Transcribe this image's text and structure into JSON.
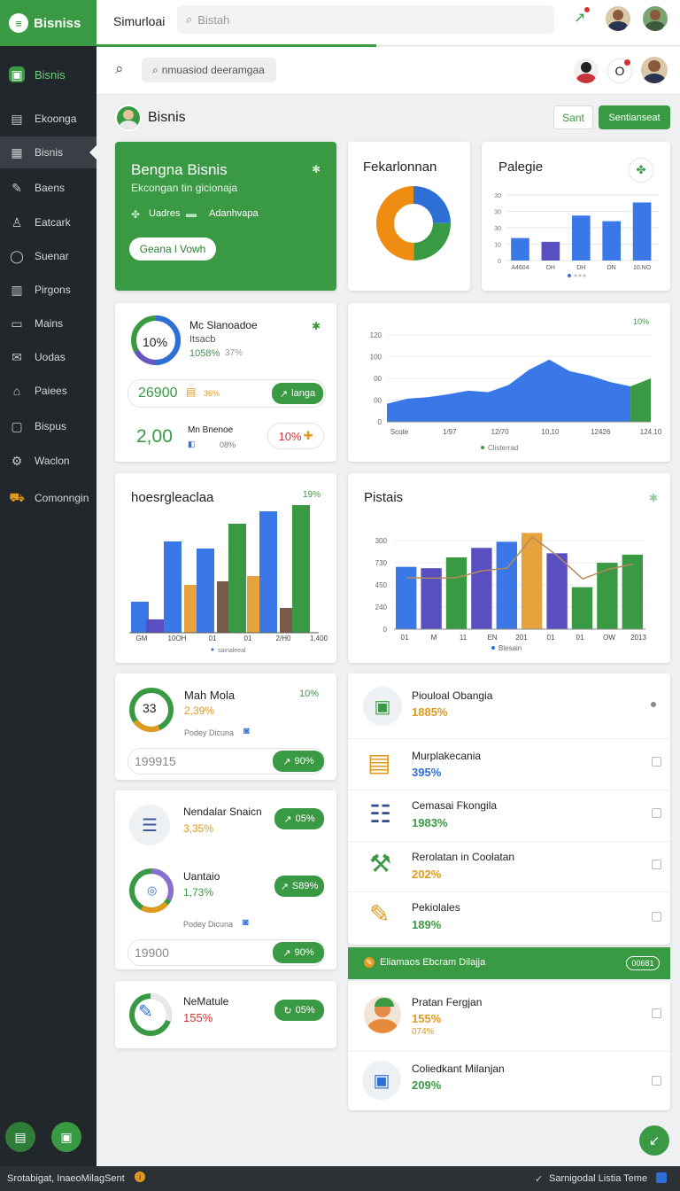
{
  "topbar": {
    "brand": "Bisniss",
    "title": "Simurloai",
    "search_placeholder": "Bistah"
  },
  "subbar": {
    "search_text": "nmuasiod deeramgaa"
  },
  "sidebar": {
    "header": "Bisnis",
    "items": [
      {
        "label": "Ekoonga",
        "icon": "briefcase-icon"
      },
      {
        "label": "Bisnis",
        "icon": "bag-icon",
        "active": true
      },
      {
        "label": "Baens",
        "icon": "wrench-icon"
      },
      {
        "label": "Eatcark",
        "icon": "person-icon"
      },
      {
        "label": "Suenar",
        "icon": "circle-icon"
      },
      {
        "label": "Pirgons",
        "icon": "cart-icon"
      },
      {
        "label": "Mains",
        "icon": "tray-icon"
      },
      {
        "label": "Uodas",
        "icon": "mail-icon"
      },
      {
        "label": "Paiees",
        "icon": "home-icon"
      },
      {
        "label": "Bispus",
        "icon": "square-icon"
      },
      {
        "label": "Waclon",
        "icon": "tools-icon"
      },
      {
        "label": "Comonngin",
        "icon": "truck-icon"
      }
    ]
  },
  "page": {
    "title": "Bisnis",
    "btn_secondary": "Sant",
    "btn_primary": "Sentianseat"
  },
  "hero": {
    "title": "Bengna Bisnis",
    "subtitle": "Ekcongan tin gicionaja",
    "tag1": "Uadres",
    "tag2": "Adanhvapa",
    "button": "Geana l Vowh"
  },
  "donut_card": {
    "title": "Fekarlonnan"
  },
  "palegie": {
    "title": "Palegie",
    "chart_data": {
      "type": "bar",
      "categories": [
        "A4604",
        "DH",
        "DH",
        "DN",
        "10.NO"
      ],
      "values": [
        12,
        10,
        24,
        21,
        31
      ],
      "y_ticks": [
        "30",
        "30",
        "30",
        "10",
        "0"
      ],
      "ylim": [
        0,
        35
      ]
    }
  },
  "stats1": {
    "ring_value": "10%",
    "title": "Mc Slanoadoe",
    "sub1": "Itsacb",
    "pct_green": "1058%",
    "pct_gray": "37%",
    "row1_value": "26900",
    "row1_pct": "36%",
    "row1_btn": "langa",
    "row2_value": "2,00",
    "row2_label": "Mn Bnenoe",
    "row2_pct": "08%",
    "row2_badge": "10%"
  },
  "area_chart": {
    "corner": "10%",
    "legend": "Clisterrad",
    "chart_data": {
      "type": "area",
      "x_labels": [
        "Scote",
        "1/97",
        "12/70",
        "10,10",
        "12426",
        "124,10"
      ],
      "values": [
        25,
        32,
        34,
        38,
        43,
        41,
        51,
        72,
        86,
        70,
        64,
        55,
        49,
        60
      ],
      "y_ticks": [
        "120",
        "100",
        "00",
        "00",
        "0"
      ],
      "ylim": [
        0,
        120
      ]
    }
  },
  "bars_chart": {
    "title": "hoesrgleaclaa",
    "corner": "19%",
    "legend": "sainaleeal",
    "chart_data": {
      "type": "bar",
      "categories": [
        "GM",
        "10OH",
        "01",
        "01",
        "2/H0",
        "1,400"
      ],
      "series": [
        {
          "values": [
            23,
            9,
            0,
            9,
            48,
            25
          ]
        },
        {
          "values": [
            52,
            55,
            47,
            50,
            73,
            91
          ]
        },
        {
          "values": [
            12,
            28,
            32,
            0,
            33,
            10
          ]
        },
        {
          "values": [
            0,
            0,
            0,
            0,
            0,
            0
          ]
        }
      ],
      "x_values": [
        5,
        12,
        32,
        34,
        37,
        70,
        72,
        62,
        48,
        51,
        65,
        80,
        21,
        100
      ],
      "ylim": [
        0,
        100
      ]
    }
  },
  "pistais": {
    "title": "Pistais",
    "legend": "Blesain",
    "chart_data": {
      "type": "bar",
      "categories": [
        "01",
        "M",
        "11",
        "EN",
        "201",
        "01",
        "01",
        "OW",
        "2013"
      ],
      "values": [
        460,
        450,
        530,
        600,
        645,
        710,
        560,
        310,
        490,
        550
      ],
      "line": [
        420,
        415,
        420,
        470,
        490,
        720,
        580,
        410,
        480,
        520
      ],
      "y_ticks": [
        "300",
        "730",
        "450",
        "240",
        "0"
      ],
      "ylim": [
        0,
        850
      ]
    }
  },
  "card_mah": {
    "ring_value": "33",
    "title": "Mah Mola",
    "pct": "2,39%",
    "corner": "10%",
    "meta": "Podey Dicuna",
    "input_value": "199915",
    "btn": "90%"
  },
  "card_nend": {
    "title": "Nendalar Snaicn",
    "pct": "3,35%",
    "btn1": "05%",
    "title2": "Uantaio",
    "pct2": "1,73%",
    "btn2": "S89%",
    "meta": "Podey Dicuna",
    "input_value": "19900",
    "btn3": "90%"
  },
  "card_ne": {
    "title": "NeMatule",
    "pct": "155%",
    "btn": "05%"
  },
  "list": [
    {
      "title": "Piouloal Obangia",
      "value": "1885%",
      "icon": "monitor-icon"
    },
    {
      "title": "Murplakecania",
      "value": "395%",
      "icon": "briefcase-icon"
    },
    {
      "title": "Cemasai Fkongila",
      "value": "1983%",
      "icon": "document-icon"
    },
    {
      "title": "Rerolatan in Coolatan",
      "value": "202%",
      "icon": "shovel-icon"
    },
    {
      "title": "Pekiolales",
      "value": "189%",
      "icon": "pen-icon"
    }
  ],
  "banner": {
    "text": "Eliamaos Ebcram Dilajja",
    "btn": "00681"
  },
  "list2": [
    {
      "title": "Pratan Fergjan",
      "value": "155%",
      "sub": "074%",
      "icon": "person-icon"
    },
    {
      "title": "Coliedkant Milanjan",
      "value": "209%",
      "icon": "screen-icon"
    }
  ],
  "statusbar": {
    "left": "Srotabigat, InaeoMilagSent",
    "right": "Sarnigodal Listia Teme"
  }
}
